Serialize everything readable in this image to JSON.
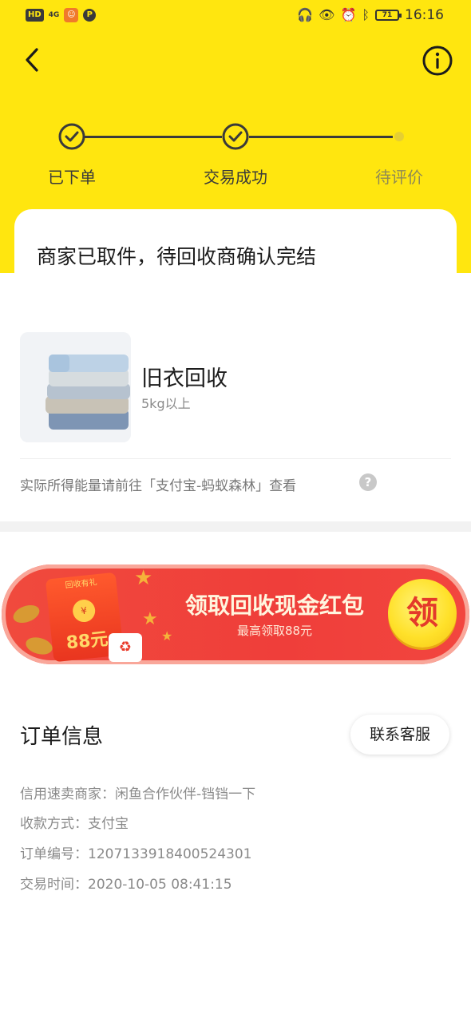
{
  "status_bar": {
    "hd": "HD",
    "signal": "4G",
    "time": "16:16",
    "battery": "71",
    "icons": [
      "headphones-icon",
      "eye-icon",
      "alarm-icon",
      "bluetooth-icon"
    ]
  },
  "nav": {
    "back_icon": "chevron-left-icon",
    "info_icon": "info-circle-icon"
  },
  "progress": {
    "steps": [
      {
        "label": "已下单",
        "state": "done"
      },
      {
        "label": "交易成功",
        "state": "done"
      },
      {
        "label": "待评价",
        "state": "pending"
      }
    ]
  },
  "status": {
    "title": "商家已取件，待回收商确认完结"
  },
  "product": {
    "name": "旧衣回收",
    "weight": "5kg以上"
  },
  "energy_note": "实际所得能量请前往「支付宝-蚂蚁森林」查看",
  "banner": {
    "envelope_top": "回收有礼",
    "envelope_coin": "¥",
    "envelope_amount": "88元",
    "title": "领取回收现金红包",
    "subtitle": "最高领取88元",
    "claim": "领"
  },
  "order": {
    "title": "订单信息",
    "contact_button": "联系客服",
    "rows": [
      {
        "label": "信用速卖商家：",
        "value": "闲鱼合作伙伴-铛铛一下"
      },
      {
        "label": "收款方式：",
        "value": "支付宝"
      },
      {
        "label": "订单编号：",
        "value": "1207133918400524301"
      },
      {
        "label": "交易时间：",
        "value": "2020-10-05 08:41:15"
      }
    ]
  },
  "colors": {
    "brand_yellow": "#ffe60f",
    "banner_red": "#ef3e3a",
    "text_dark": "#1c1c1c",
    "text_gray": "#8a8a8a"
  }
}
